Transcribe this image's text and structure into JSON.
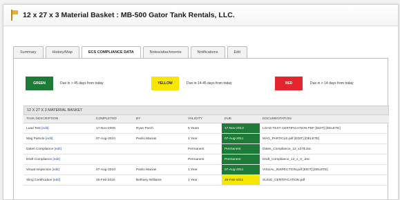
{
  "window": {
    "title": "12 x 27 x 3 Material Basket : MB-500 Gator Tank Rentals, LLC."
  },
  "tabs": [
    {
      "label": "Summary",
      "active": false
    },
    {
      "label": "History/Map",
      "active": false
    },
    {
      "label": "ECS COMPLIANCE DATA",
      "active": true
    },
    {
      "label": "Notes/attachments",
      "active": false
    },
    {
      "label": "Notifications",
      "active": false
    },
    {
      "label": "Edit",
      "active": false
    }
  ],
  "legend": [
    {
      "label": "GREEN",
      "desc": "Due in > 45 days from today",
      "bg": "#1d7a37",
      "fg": "#ffffff"
    },
    {
      "label": "YELLOW",
      "desc": "Due in 14-45 days from today",
      "bg": "#f7e600",
      "fg": "#222222"
    },
    {
      "label": "RED",
      "desc": "Due in < 14 days from today",
      "bg": "#e3262d",
      "fg": "#ffffff"
    }
  ],
  "table": {
    "title": "12 X 27 X 3 MATERIAL BASKET",
    "columns": [
      "TASK DESCRIPTION",
      "COMPLETED",
      "BY",
      "VALIDITY",
      "DUE",
      "DOCUMENTATION"
    ],
    "rows": [
      {
        "task": "Load Test",
        "edit": "[edit]",
        "completed": "17-Nov-2008",
        "by": "Ryan Porch",
        "validity": "5 Years",
        "due": "17-Nov-2013",
        "due_status": "green",
        "doc": "LOAD TEST CERTIFICATION.PDF [EDIT] [DELETE]"
      },
      {
        "task": "Mag Particle",
        "edit": "[edit]",
        "completed": "07-Aug-2010",
        "by": "Pedro Macias",
        "validity": "1 Year",
        "due": "07-Aug-2011",
        "due_status": "green",
        "doc": "MAG_PARTICLE.pdf [EDIT] [DELETE]"
      },
      {
        "task": "Dates Compliance",
        "edit": "[edit]",
        "completed": "",
        "by": "",
        "validity": "Permanent",
        "due": "Permanent",
        "due_status": "green",
        "doc": "Dates_Compliance_12_x27$.doc"
      },
      {
        "task": "Draft Compliance",
        "edit": "[edit]",
        "completed": "",
        "by": "",
        "validity": "Permanent",
        "due": "Permanent",
        "due_status": "green",
        "doc": "Draft_Compliance_12_x_3_.doc"
      },
      {
        "task": "Visual Inspection",
        "edit": "[edit]",
        "completed": "07-Aug-2010",
        "by": "Pedro Macias",
        "validity": "1 Year",
        "due": "07-Aug-2011",
        "due_status": "green",
        "doc": "VISUAL_INSPECTION.pdf [EDIT] [DELETE]"
      },
      {
        "task": "Sling Certification",
        "edit": "[edit]",
        "completed": "26-Feb-2010",
        "by": "Bethany Williams",
        "validity": "1 Year",
        "due": "26-Feb-2011",
        "due_status": "yellow",
        "doc": "SLING_CERTIFICATION.pdf"
      }
    ]
  }
}
